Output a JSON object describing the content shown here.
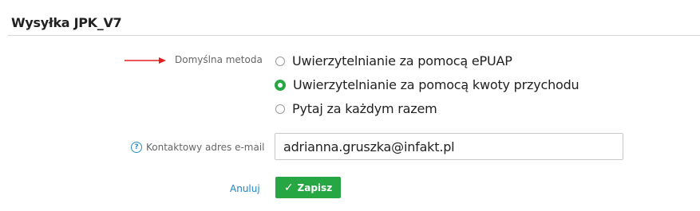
{
  "section": {
    "title": "Wysyłka JPK_V7"
  },
  "method": {
    "label": "Domyślna metoda",
    "options": [
      {
        "label": "Uwierzytelnianie za pomocą ePUAP",
        "selected": false
      },
      {
        "label": "Uwierzytelnianie za pomocą kwoty przychodu",
        "selected": true
      },
      {
        "label": "Pytaj za każdym razem",
        "selected": false
      }
    ]
  },
  "email": {
    "label": "Kontaktowy adres e-mail",
    "value": "adrianna.gruszka@infakt.pl",
    "help_icon_glyph": "?"
  },
  "actions": {
    "cancel_label": "Anuluj",
    "save_label": "Zapisz",
    "save_icon_glyph": "✓"
  },
  "colors": {
    "accent_green": "#27a744",
    "link_blue": "#1c86c7",
    "annotation_arrow": "#e02020"
  },
  "icons": {
    "annotation": "arrow-right-icon",
    "help": "question-circle-icon",
    "save": "check-icon"
  }
}
